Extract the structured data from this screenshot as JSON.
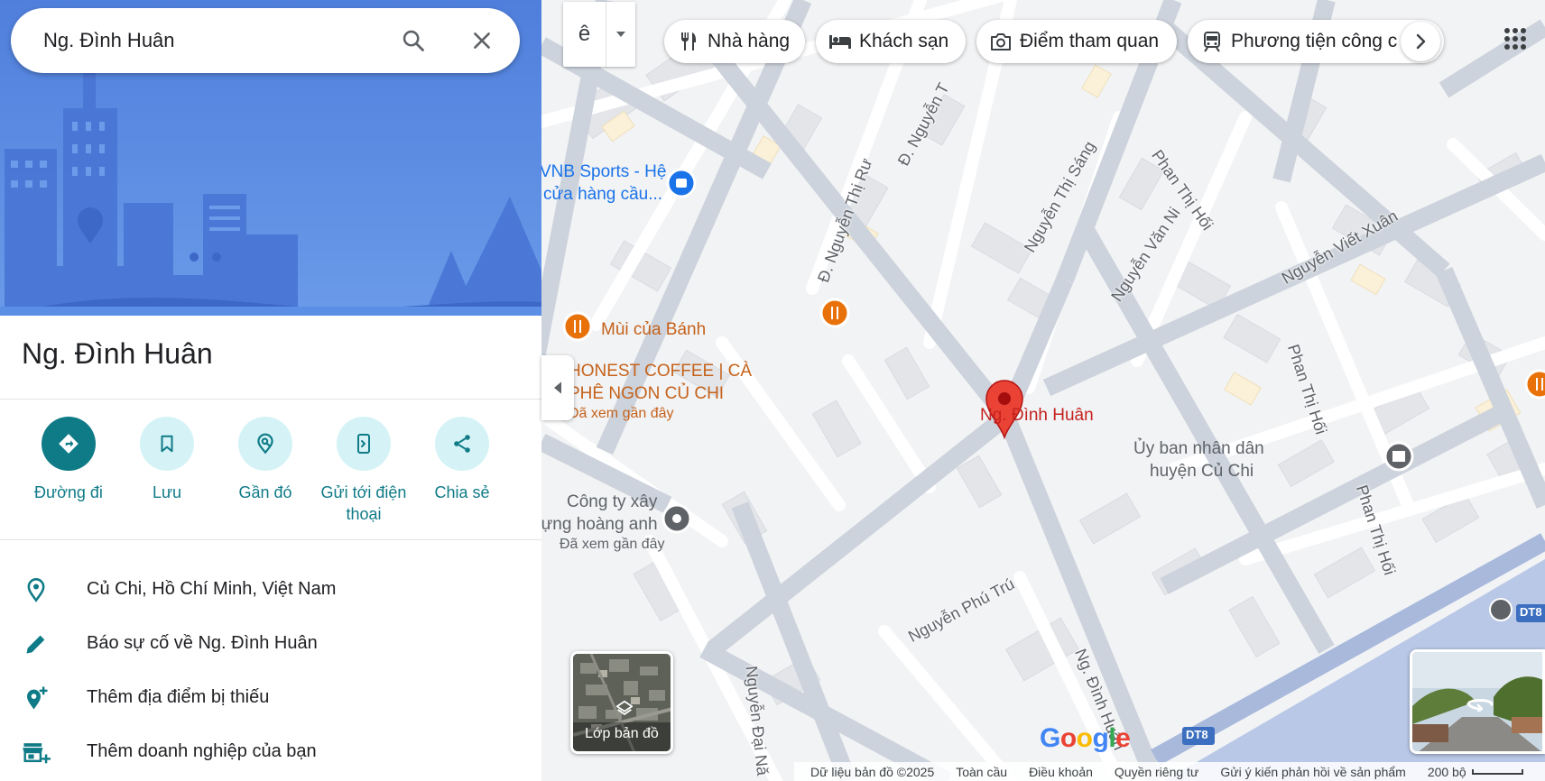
{
  "search": {
    "value": "Ng. Đình Huân"
  },
  "place": {
    "title": "Ng. Đình Huân"
  },
  "actions": [
    {
      "label": "Đường đi"
    },
    {
      "label": "Lưu"
    },
    {
      "label": "Gần đó"
    },
    {
      "label": "Gửi tới điện thoại"
    },
    {
      "label": "Chia sẻ"
    }
  ],
  "info_rows": [
    {
      "icon": "location-pin-icon",
      "text": "Củ Chi, Hồ Chí Minh, Việt Nam"
    },
    {
      "icon": "pencil-icon",
      "text": "Báo sự cố về Ng. Đình Huân"
    },
    {
      "icon": "add-place-icon",
      "text": "Thêm địa điểm bị thiếu"
    },
    {
      "icon": "add-business-icon",
      "text": "Thêm doanh nghiệp của bạn"
    }
  ],
  "input_tool": {
    "glyph": "ê"
  },
  "chips": [
    {
      "label": "Nhà hàng",
      "icon": "fork-knife-icon"
    },
    {
      "label": "Khách sạn",
      "icon": "bed-icon"
    },
    {
      "label": "Điểm tham quan",
      "icon": "camera-icon"
    },
    {
      "label": "Phương tiện công c",
      "icon": "train-icon"
    }
  ],
  "map_labels": {
    "vnb_line1": "VNB Sports - Hệ",
    "vnb_line2": "cửa hàng cầu...",
    "mui_cua_banh": "Mùi của Bánh",
    "honest_line1": "HONEST COFFEE | CÀ",
    "honest_line2": "PHÊ NGON CỦ CHI",
    "honest_sub": "Đã xem gần đây",
    "congty_line1": "Công ty xây",
    "congty_line2": "dựng hoàng anh",
    "congty_sub": "Đã xem gần đây",
    "pin_label": "Ng. Đình Huân",
    "ubnd_line1": "Ủy ban nhân dân",
    "ubnd_line2": "huyện Củ Chi"
  },
  "streets": {
    "s1": "Đ. Nguyễn Thị Rư",
    "s2": "Đ. Nguyễn T",
    "s3": "Nguyễn Thị Sáng",
    "s4": "Phan Thị Hối",
    "s5": "Nguyễn Văn Ni",
    "s6": "Nguyễn Viết Xuân",
    "s7": "Phan Thị Hối",
    "s8": "Phan Thị Hối",
    "s9": "Nguyễn Phú Trú",
    "s10": "Ng. Đình Huân",
    "s11": "Nguyễn Đại Nă",
    "shield1": "DT8",
    "shield2": "DT8"
  },
  "layers": {
    "label": "Lớp bản đồ"
  },
  "footer": {
    "data": "Dữ liệu bản đồ ©2025",
    "global": "Toàn cầu",
    "terms": "Điều khoản",
    "privacy": "Quyền riêng tư",
    "feedback": "Gửi ý kiến phản hồi về sản phẩm",
    "scale": "200 bộ"
  },
  "colors": {
    "teal": "#0f7b87",
    "pin_red": "#ea4335",
    "food_orange": "#e8710a",
    "hero_blue": "#5b8fe6"
  }
}
